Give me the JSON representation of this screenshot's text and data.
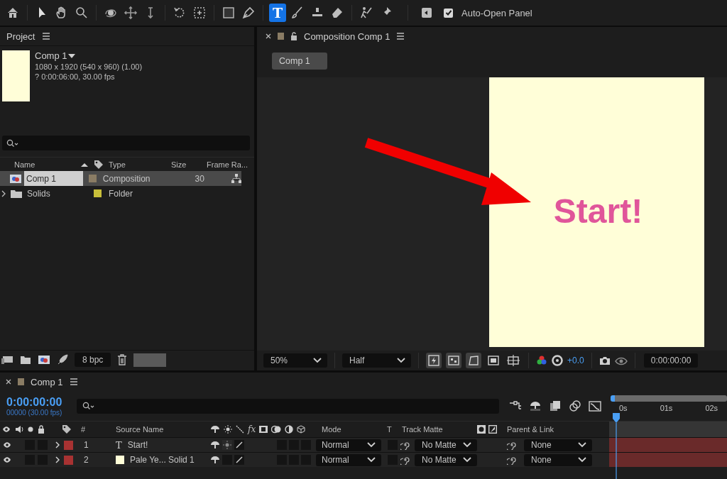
{
  "toolbar": {
    "tools": [
      {
        "kind": "home",
        "selected": false
      },
      {
        "kind": "selection",
        "selected": false
      },
      {
        "kind": "hand",
        "selected": false
      },
      {
        "kind": "zoom",
        "selected": false
      },
      {
        "kind": "orbit",
        "selected": false
      },
      {
        "kind": "pan",
        "selected": false
      },
      {
        "kind": "dolly",
        "selected": false
      },
      {
        "kind": "rotate",
        "selected": false
      },
      {
        "kind": "anchor",
        "selected": false
      },
      {
        "kind": "rectangle",
        "selected": false
      },
      {
        "kind": "pen",
        "selected": false
      },
      {
        "kind": "type",
        "glyph": "T",
        "selected": true
      },
      {
        "kind": "brush",
        "selected": false
      },
      {
        "kind": "stamp",
        "selected": false
      },
      {
        "kind": "eraser",
        "selected": false
      },
      {
        "kind": "puppet",
        "selected": false
      },
      {
        "kind": "pin",
        "selected": false
      }
    ],
    "auto_open": {
      "label": "Auto-Open Panel",
      "checked": true
    }
  },
  "project": {
    "title": "Project",
    "item": {
      "name": "Comp 1",
      "dimensions": "1080 x 1920  (540 x 960) (1.00)",
      "duration": "? 0:00:06:00, 30.00 fps"
    },
    "columns": [
      "Name",
      "Type",
      "Size",
      "Frame Ra..."
    ],
    "rows": [
      {
        "kind": "composition",
        "name": "Comp 1",
        "type": "Composition",
        "frame_rate": "30",
        "color": "#8a7c64",
        "selected": true
      },
      {
        "kind": "folder",
        "name": "Solids",
        "type": "Folder",
        "color": "#c8bf3a",
        "selected": false
      }
    ],
    "bit_depth": "8 bpc"
  },
  "viewer": {
    "tab": "Composition Comp 1",
    "breadcrumb": "Comp 1",
    "canvas_text": "Start!",
    "zoom": "50%",
    "resolution": "Half",
    "toggles": [
      {
        "kind": "fast-preview",
        "on": true
      },
      {
        "kind": "grid",
        "on": true
      },
      {
        "kind": "mask",
        "on": true
      },
      {
        "kind": "region",
        "on": false
      },
      {
        "kind": "guides",
        "on": false
      }
    ],
    "exposure": "+0.0",
    "timecode": "0:00:00:00"
  },
  "timeline": {
    "tab": "Comp 1",
    "timecode": "0:00:00:00",
    "frames": "00000 (30.00 fps)",
    "ruler": [
      "0s",
      "01s",
      "02s"
    ],
    "columns": {
      "index": "#",
      "source_name": "Source Name",
      "effects": "fx",
      "mode": "Mode",
      "preserve": "T",
      "track_matte": "Track Matte",
      "parent": "Parent & Link"
    },
    "layers": [
      {
        "index": "1",
        "kind": "text",
        "glyph": "T",
        "name": "Start!",
        "color": "#a83232",
        "visible": true,
        "mode": "Normal",
        "track_matte": "No Matte",
        "parent": "None"
      },
      {
        "index": "2",
        "kind": "solid",
        "name": "Pale Ye... Solid 1",
        "color": "#a83232",
        "visible": true,
        "mode": "Normal",
        "track_matte": "No Matte",
        "parent": "None"
      }
    ]
  }
}
